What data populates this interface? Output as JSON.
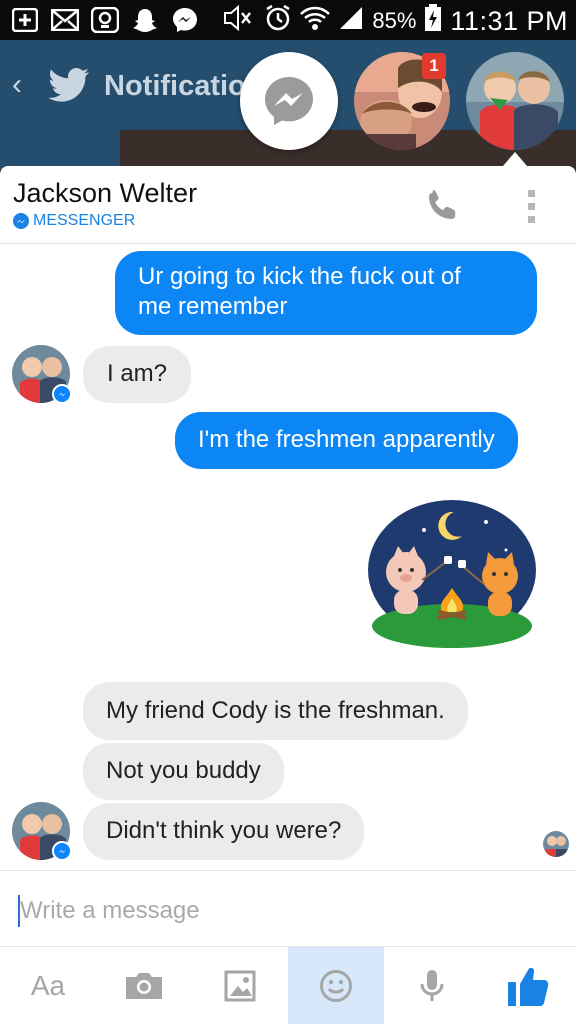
{
  "status_bar": {
    "battery": "85%",
    "time": "11:31 PM",
    "icons": [
      "add-icon",
      "email-icon",
      "voicemail-icon",
      "snapchat-icon",
      "messenger-icon",
      "mute-icon",
      "alarm-icon",
      "wifi-icon",
      "signal-icon",
      "battery-charging-icon"
    ]
  },
  "background_app": {
    "title": "Notificatio"
  },
  "chat_heads": {
    "badge_count": "1"
  },
  "chat": {
    "contact_name": "Jackson Welter",
    "subtitle": "MESSENGER",
    "messages": [
      {
        "side": "out",
        "text_line1": "Ur going to kick the fuck out of",
        "text_line2": "me remember"
      },
      {
        "side": "in",
        "text": "I am?"
      },
      {
        "side": "out",
        "text": "I'm the freshmen apparently"
      },
      {
        "side": "in",
        "text": "My friend Cody is the freshman."
      },
      {
        "side": "in",
        "text": "Not you buddy"
      },
      {
        "side": "in",
        "text": "Didn't think you were?"
      }
    ]
  },
  "composer": {
    "placeholder": "Write a message"
  },
  "toolbar": {
    "text_label": "Aa",
    "items": [
      "text-format-icon",
      "camera-icon",
      "gallery-icon",
      "emoji-icon",
      "microphone-icon",
      "like-icon"
    ]
  },
  "colors": {
    "accent": "#0c86f4",
    "incoming_bubble": "#ebebeb",
    "twitter_bar": "#254e6e"
  }
}
